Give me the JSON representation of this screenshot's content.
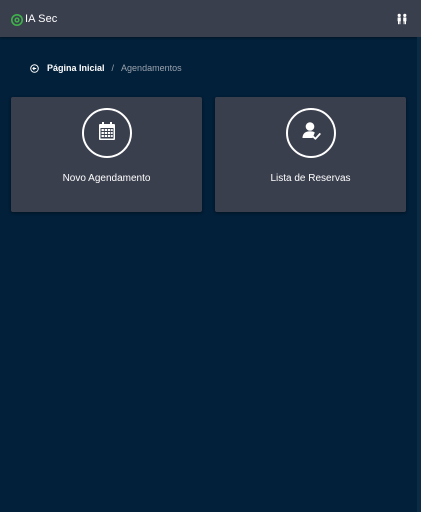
{
  "header": {
    "app_name": "IA Sec",
    "logo_icon": "logo-icon",
    "user_icon": "users-icon"
  },
  "breadcrumb": {
    "back_icon": "back-arrow-icon",
    "home_label": "Página Inicial",
    "separator": "/",
    "current_label": "Agendamentos"
  },
  "cards": [
    {
      "label": "Novo Agendamento",
      "icon": "calendar-icon"
    },
    {
      "label": "Lista de Reservas",
      "icon": "user-check-icon"
    }
  ],
  "colors": {
    "background": "#02203a",
    "surface": "#3a3f4e",
    "text": "#ffffff",
    "muted_text": "#9aa3ae",
    "logo_green": "#3fb24a"
  }
}
